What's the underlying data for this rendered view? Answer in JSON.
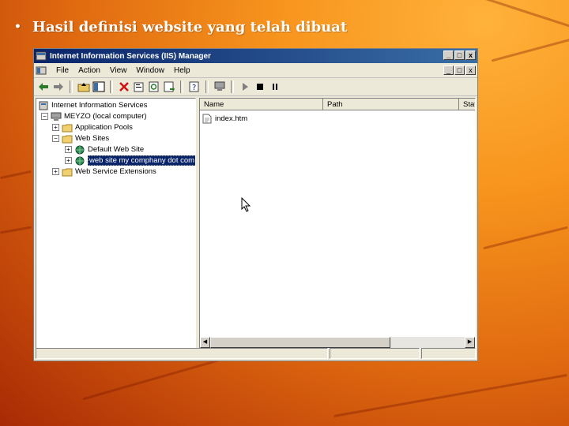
{
  "slide": {
    "bullet": "Hasil definisi website yang telah dibuat"
  },
  "window": {
    "title": "Internet Information Services (IIS) Manager",
    "controls": {
      "minimize": "_",
      "maximize": "□",
      "close": "x"
    }
  },
  "menu": {
    "items": [
      "File",
      "Action",
      "View",
      "Window",
      "Help"
    ]
  },
  "toolbar": {
    "icons": [
      "back-arrow-icon",
      "forward-arrow-icon",
      "up-folder-icon",
      "show-hide-tree-icon",
      "delete-icon",
      "properties-icon",
      "refresh-icon",
      "export-list-icon",
      "help-icon",
      "computer-icon",
      "play-icon",
      "stop-icon",
      "pause-icon"
    ]
  },
  "tree": {
    "root": "Internet Information Services",
    "computer": "MEYZO (local computer)",
    "app_pools": "Application Pools",
    "web_sites": "Web Sites",
    "default_site": "Default Web Site",
    "custom_site": "web site my comphany dot com",
    "extensions": "Web Service Extensions"
  },
  "list": {
    "columns": [
      "Name",
      "Path",
      "Statu"
    ],
    "rows": [
      {
        "name": "index.htm",
        "path": "",
        "status": ""
      }
    ]
  },
  "colors": {
    "titlebar_start": "#0a246a",
    "titlebar_end": "#3a6ea5",
    "window_face": "#ece9d8",
    "selection": "#0a246a"
  }
}
